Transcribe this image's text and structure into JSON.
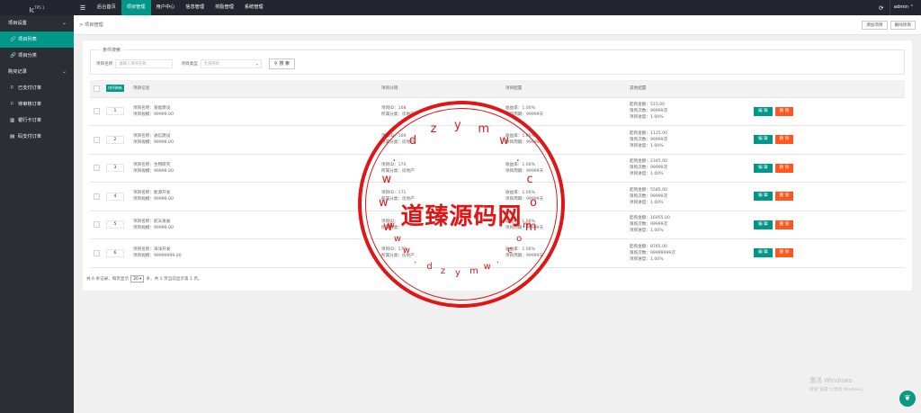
{
  "logo": {
    "main": "lc",
    "sup": "TP5.1"
  },
  "sidebar": {
    "group1": "项目设置",
    "items1": [
      {
        "label": "项目列表",
        "icon": "link-icon",
        "glyph": "🔗"
      },
      {
        "label": "项目分类",
        "icon": "link-icon",
        "glyph": "🔗"
      }
    ],
    "group2": "购买记录",
    "items2": [
      {
        "label": "已支付订单",
        "icon": "flag-icon",
        "glyph": "⚐"
      },
      {
        "label": "待审核订单",
        "icon": "flag-icon",
        "glyph": "⚐"
      },
      {
        "label": "银行卡订单",
        "icon": "bank-icon",
        "glyph": "▥"
      },
      {
        "label": "码支付订单",
        "icon": "list-icon",
        "glyph": "▤"
      }
    ]
  },
  "topbar": {
    "toggle": "☰",
    "nav": [
      "后台首页",
      "项目管理",
      "用户中心",
      "信息管理",
      "奖励管理",
      "系统管理"
    ],
    "refresh": "⟳",
    "user": "admin ⌃"
  },
  "breadcrumb": {
    "text": "> 项目管理",
    "add": "添加项目",
    "delete": "删除项目"
  },
  "search": {
    "legend": "条件搜索",
    "name_label": "项目名称",
    "name_placeholder": "请输入项目名称",
    "cat_label": "项目类型",
    "cat_value": "全部项目",
    "button": "搜 索",
    "button_icon": "⚲"
  },
  "table": {
    "headers": {
      "sort": "排序刷新",
      "info": "项目信息",
      "dist": "项目分销",
      "config": "项目配置",
      "other": "其他配置"
    },
    "rows": [
      {
        "sort": "1",
        "name": "项目名称：基础建设",
        "scale": "项目规模：99999.00",
        "id": "项目ID：168",
        "cat": "所属分类：房地产",
        "rate": "收益率：1.00%",
        "period": "项目周期：99999天",
        "amount": "起购金额：515.00",
        "times": "限购次数：99999次",
        "progress": "项目进度：1.00%"
      },
      {
        "sort": "2",
        "name": "项目名称：通信建设",
        "scale": "项目规模：99999.00",
        "id": "项目ID：169",
        "cat": "所属分类：房地产",
        "rate": "收益率：1.00%",
        "period": "项目周期：99999天",
        "amount": "起购金额：1125.00",
        "times": "限购次数：99999次",
        "progress": "项目进度：1.00%"
      },
      {
        "sort": "3",
        "name": "项目名称：生物研究",
        "scale": "项目规模：99999.00",
        "id": "项目ID：170",
        "cat": "所属分类：房地产",
        "rate": "收益率：1.00%",
        "period": "项目周期：99999天",
        "amount": "起购金额：2345.00",
        "times": "限购次数：99999次",
        "progress": "项目进度：1.00%"
      },
      {
        "sort": "4",
        "name": "项目名称：能源开发",
        "scale": "项目规模：99999.00",
        "id": "项目ID：171",
        "cat": "所属分类：房地产",
        "rate": "收益率：1.00%",
        "period": "项目周期：99999天",
        "amount": "起购金额：5585.00",
        "times": "限购次数：99999次",
        "progress": "项目进度：1.00%"
      },
      {
        "sort": "5",
        "name": "项目名称：航天发展",
        "scale": "项目规模：99999.00",
        "id": "项目ID：",
        "cat": "所属分类：",
        "rate": "收益率：1.00%",
        "period": "项目周期：99999天",
        "amount": "起购金额：16955.00",
        "times": "限购次数：99999次",
        "progress": "项目进度：1.00%"
      },
      {
        "sort": "6",
        "name": "项目名称：海洋开发",
        "scale": "项目规模：99999999.00",
        "id": "项目ID：172",
        "cat": "所属分类：房地产",
        "rate": "收益率：1.00%",
        "period": "项目周期：99999天",
        "amount": "起购金额：8765.00",
        "times": "限购次数：99999999次",
        "progress": "项目进度：1.00%"
      }
    ],
    "edit": "编 辑",
    "delete": "删 除"
  },
  "pager": {
    "prefix": "共 6 条记录，每页显示",
    "size": "20 ▾",
    "suffix": "条，共 1 页当前显示第 1 页。"
  },
  "stamp": {
    "main": "道臻源码网"
  },
  "windows": {
    "line1": "激活 Windows",
    "line2": "转到\"设置\"以激活 Windows。"
  },
  "colors": {
    "accent": "#009688",
    "danger": "#ff5722",
    "sidebar": "#2b2e35",
    "stamp": "#e01616"
  }
}
